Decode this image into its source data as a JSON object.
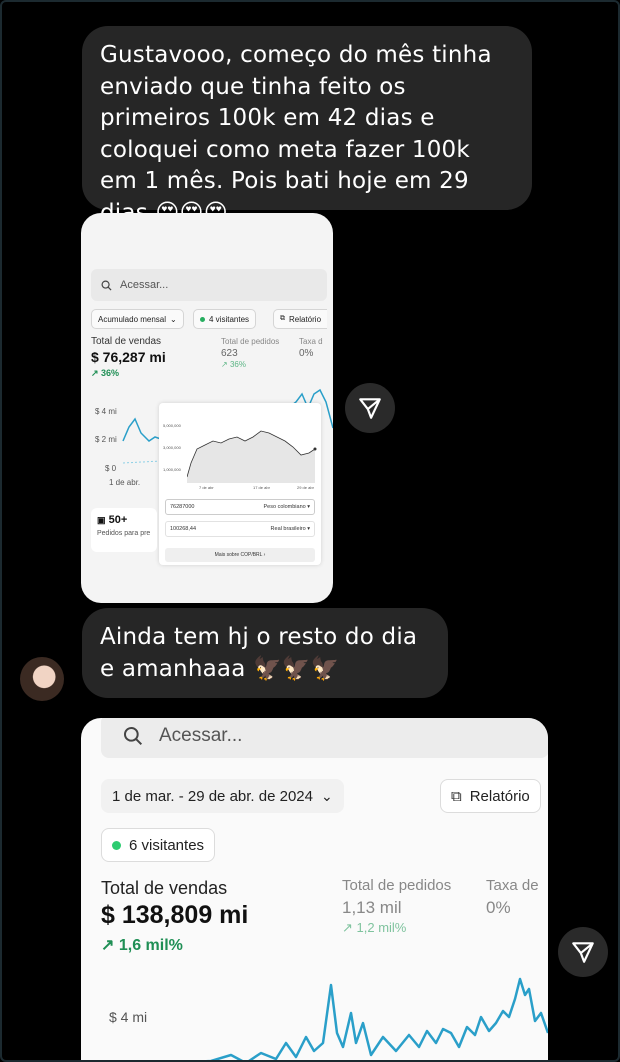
{
  "messages": {
    "msg1": "Gustavooo, começo do mês tinha enviado que tinha feito os primeiros 100k em 42 dias e coloquei como meta fazer 100k em 1 mês. Pois bati hoje em 29 dias 😍😍😍",
    "msg2": "Ainda tem hj o resto do dia e amanhaaa 🦅🦅🦅"
  },
  "shot1": {
    "search_placeholder": "Acessar...",
    "period_chip": "Acumulado mensal",
    "visitors_chip": "4 visitantes",
    "report_chip": "Relatório",
    "sales_label": "Total de vendas",
    "sales_value": "$ 76,287 mi",
    "sales_growth": "36%",
    "orders_label": "Total de pedidos",
    "orders_value": "623",
    "orders_growth": "36%",
    "rate_label": "Taxa d",
    "rate_value": "0%",
    "y_ticks": [
      "$ 4 mi",
      "$ 2 mi",
      "$ 0"
    ],
    "x_tick": "1 de abr.",
    "orders_count": "50+",
    "orders_sub": "Pedidos para pre",
    "overlay": {
      "y_ticks": [
        "5,000,000",
        "3,000,000",
        "1,000,000"
      ],
      "x_ticks": [
        "7 de abr",
        "17 de abr",
        "29 de abr"
      ],
      "field1_value": "76287000",
      "field1_currency": "Peso colombiano",
      "field2_value": "100268,44",
      "field2_currency": "Real brasileiro",
      "more_button": "Mais sobre COP/BRL"
    }
  },
  "shot2": {
    "search_placeholder": "Acessar...",
    "date_range": "1 de mar. - 29 de abr. de 2024",
    "report_button": "Relatório",
    "visitors_chip": "6 visitantes",
    "sales_label": "Total de vendas",
    "sales_value": "$ 138,809 mi",
    "sales_growth": "1,6 mil%",
    "orders_label": "Total de pedidos",
    "orders_value": "1,13 mil",
    "orders_growth": "1,2 mil%",
    "rate_label": "Taxa de",
    "rate_value": "0%",
    "y_tick": "$ 4 mi"
  },
  "colors": {
    "bubble": "#262626",
    "accent_green": "#1f8f55",
    "chart_line": "#2a9fc9"
  }
}
